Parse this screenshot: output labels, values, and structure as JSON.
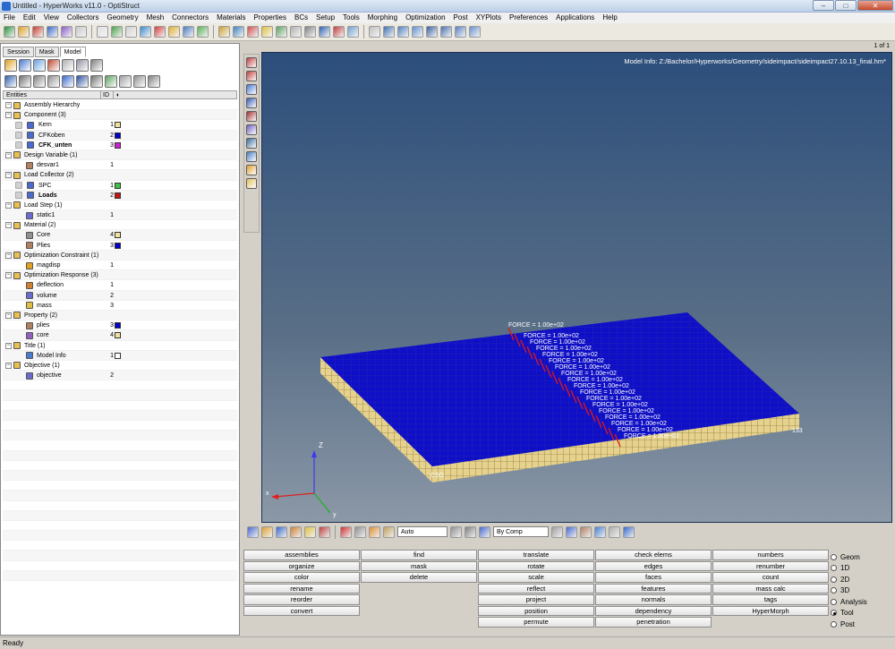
{
  "window": {
    "title": "Untitled - HyperWorks v11.0 - OptiStruct"
  },
  "menu": [
    "File",
    "Edit",
    "View",
    "Collectors",
    "Geometry",
    "Mesh",
    "Connectors",
    "Materials",
    "Properties",
    "BCs",
    "Setup",
    "Tools",
    "Morphing",
    "Optimization",
    "Post",
    "XYPlots",
    "Preferences",
    "Applications",
    "Help"
  ],
  "tabs": [
    "Session",
    "Mask",
    "Model"
  ],
  "grid": {
    "col_entities": "Entities",
    "col_id": "ID"
  },
  "tree": [
    {
      "label": "Assembly Hierarchy",
      "level": 0,
      "id": "",
      "color": ""
    },
    {
      "label": "Component (3)",
      "level": 0,
      "id": "",
      "color": ""
    },
    {
      "label": "Kern",
      "level": 2,
      "id": "1",
      "color": "#f3e39a"
    },
    {
      "label": "CFKoben",
      "level": 2,
      "id": "2",
      "color": "#0000c8"
    },
    {
      "label": "CFK_unten",
      "level": 2,
      "id": "3",
      "color": "#d21fd2",
      "bold": true
    },
    {
      "label": "Design Variable (1)",
      "level": 0,
      "id": "",
      "color": ""
    },
    {
      "label": "desvar1",
      "level": 1,
      "id": "1",
      "color": ""
    },
    {
      "label": "Load Collector (2)",
      "level": 0,
      "id": "",
      "color": ""
    },
    {
      "label": "SPC",
      "level": 2,
      "id": "1",
      "color": "#3fc43f"
    },
    {
      "label": "Loads",
      "level": 2,
      "id": "2",
      "color": "#c81414",
      "bold": true
    },
    {
      "label": "Load Step (1)",
      "level": 0,
      "id": "",
      "color": ""
    },
    {
      "label": "static1",
      "level": 1,
      "id": "1",
      "color": ""
    },
    {
      "label": "Material (2)",
      "level": 0,
      "id": "",
      "color": ""
    },
    {
      "label": "Core",
      "level": 1,
      "id": "4",
      "color": "#f3e39a"
    },
    {
      "label": "Plies",
      "level": 1,
      "id": "3",
      "color": "#0000c8"
    },
    {
      "label": "Optimization Constraint (1)",
      "level": 0,
      "id": "",
      "color": ""
    },
    {
      "label": "magdisp",
      "level": 1,
      "id": "1",
      "color": ""
    },
    {
      "label": "Optimization Response (3)",
      "level": 0,
      "id": "",
      "color": ""
    },
    {
      "label": "deflection",
      "level": 1,
      "id": "1",
      "color": ""
    },
    {
      "label": "volume",
      "level": 1,
      "id": "2",
      "color": ""
    },
    {
      "label": "mass",
      "level": 1,
      "id": "3",
      "color": ""
    },
    {
      "label": "Property (2)",
      "level": 0,
      "id": "",
      "color": ""
    },
    {
      "label": "plies",
      "level": 1,
      "id": "3",
      "color": "#0000c8"
    },
    {
      "label": "core",
      "level": 1,
      "id": "4",
      "color": "#f3e39a"
    },
    {
      "label": "Title (1)",
      "level": 0,
      "id": "",
      "color": ""
    },
    {
      "label": "Model Info",
      "level": 1,
      "id": "1",
      "color": "#ffffff"
    },
    {
      "label": "Objective (1)",
      "level": 0,
      "id": "",
      "color": ""
    },
    {
      "label": "objective",
      "level": 1,
      "id": "2",
      "color": ""
    }
  ],
  "viewport": {
    "model_info": "Model Info: Z:/Bachelor/Hyperworks/Geometry/sideimpact/sideimpact27.10.13_final.hm*",
    "page_count": "1 of 1",
    "force_label": "FORCE = 1.00e+02",
    "axis_z": "Z",
    "node_label_right": "133",
    "node_label_left": "CSG"
  },
  "bottom_toolbar": {
    "auto_combo": "Auto",
    "bycomp_combo": "By Comp"
  },
  "panel_buttons": [
    [
      "assemblies",
      "organize",
      "color",
      "rename",
      "reorder",
      "convert"
    ],
    [
      "find",
      "mask",
      "delete"
    ],
    [
      "translate",
      "rotate",
      "scale",
      "reflect",
      "project",
      "position",
      "permute"
    ],
    [
      "check elems",
      "edges",
      "faces",
      "features",
      "normals",
      "dependency",
      "penetration"
    ],
    [
      "numbers",
      "renumber",
      "count",
      "mass calc",
      "tags",
      "HyperMorph"
    ]
  ],
  "radios": [
    {
      "label": "Geom",
      "on": false
    },
    {
      "label": "1D",
      "on": false
    },
    {
      "label": "2D",
      "on": false
    },
    {
      "label": "3D",
      "on": false
    },
    {
      "label": "Analysis",
      "on": false
    },
    {
      "label": "Tool",
      "on": true
    },
    {
      "label": "Post",
      "on": false
    }
  ],
  "status": "Ready",
  "colors": {
    "ply_blue": "#0f0fc8",
    "core_yellow": "#e6d28c",
    "force_red": "#e01818",
    "viewport_top": "#2c4e7b"
  }
}
